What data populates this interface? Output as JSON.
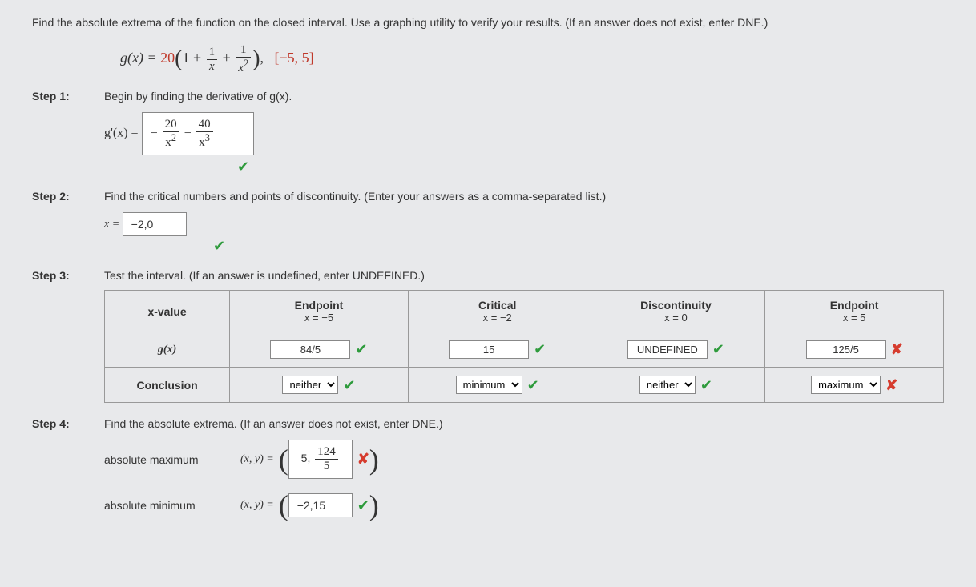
{
  "question": "Find the absolute extrema of the function on the closed interval. Use a graphing utility to verify your results. (If an answer does not exist, enter DNE.)",
  "func_lhs": "g(x) = ",
  "func_coeff": "20",
  "frac1_num": "1",
  "frac1_den": "x",
  "frac2_num": "1",
  "frac2_den": "x",
  "frac2_den_exp": "2",
  "interval": "[−5, 5]",
  "step1_label": "Step 1:",
  "step1_text": "Begin by finding the derivative of g(x).",
  "gprime_lhs": "g'(x) = ",
  "deriv_t1_num": "20",
  "deriv_t1_den": "x",
  "deriv_t1_exp": "2",
  "deriv_t2_num": "40",
  "deriv_t2_den": "x",
  "deriv_t2_exp": "3",
  "step2_label": "Step 2:",
  "step2_text": "Find the critical numbers and points of discontinuity. (Enter your answers as a comma-separated list.)",
  "x_eq": "x = ",
  "step2_answer": "−2,0",
  "step3_label": "Step 3:",
  "step3_text": "Test the interval. (If an answer is undefined, enter UNDEFINED.)",
  "tbl": {
    "h_xval": "x-value",
    "h_ep1": "Endpoint",
    "h_ep1_sub": "x = −5",
    "h_crit": "Critical",
    "h_crit_sub": "x = −2",
    "h_disc": "Discontinuity",
    "h_disc_sub": "x = 0",
    "h_ep2": "Endpoint",
    "h_ep2_sub": "x = 5",
    "r_gx": "g(x)",
    "v1": "84/5",
    "v2": "15",
    "v3": "UNDEFINED",
    "v4": "125/5",
    "r_concl": "Conclusion",
    "c1": "neither",
    "c2": "minimum",
    "c3": "neither",
    "c4": "maximum"
  },
  "step4_label": "Step 4:",
  "step4_text": "Find the absolute extrema. (If an answer does not exist, enter DNE.)",
  "absmax_label": "absolute maximum",
  "absmin_label": "absolute minimum",
  "xy_label": "(x, y) = ",
  "absmax_x": "5,",
  "absmax_y_num": "124",
  "absmax_y_den": "5",
  "absmin_val": "−2,15"
}
